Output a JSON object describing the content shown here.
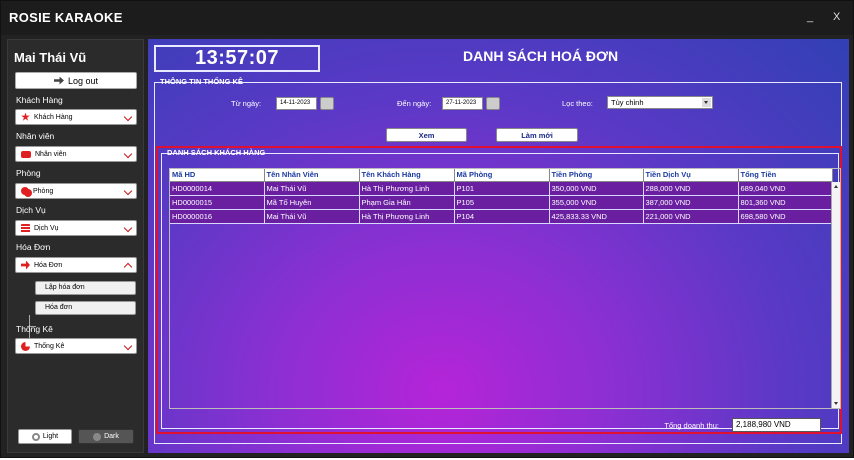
{
  "window": {
    "title": "ROSIE KARAOKE",
    "minimize": "_",
    "close": "X"
  },
  "sidebar": {
    "user_name": "Mai Thái Vũ",
    "logout_label": "Log out",
    "sections": [
      {
        "label": "Khách Hàng",
        "combo": "Khách Hàng",
        "icon": "star-icon"
      },
      {
        "label": "Nhân viên",
        "combo": "Nhân viên",
        "icon": "users-icon"
      },
      {
        "label": "Phòng",
        "combo": "Phòng",
        "icon": "room-icon"
      },
      {
        "label": "Dịch Vụ",
        "combo": "Dịch Vụ",
        "icon": "service-icon"
      },
      {
        "label": "Hóa Đơn",
        "combo": "Hóa Đơn",
        "icon": "invoice-icon"
      },
      {
        "label": "Thống Kê",
        "combo": "Thống Kê",
        "icon": "pie-chart-icon"
      }
    ],
    "invoice_subitems": [
      "Lập hóa đơn",
      "Hóa đơn"
    ],
    "light_label": "Light",
    "dark_label": "Dark"
  },
  "main": {
    "clock": "13:57:07",
    "page_title": "DANH SÁCH HOÁ ĐƠN",
    "stats_group_title": "THÔNG TIN THỐNG KÊ",
    "from_label": "Từ ngày:",
    "from_value": "14-11-2023",
    "to_label": "Đến ngày:",
    "to_value": "27-11-2023",
    "filter_label": "Lọc theo:",
    "filter_value": "Tùy chỉnh",
    "view_button": "Xem",
    "refresh_button": "Làm mới",
    "list_group_title": "DANH SÁCH KHÁCH HÀNG",
    "columns": [
      "Mã HD",
      "Tên Nhân Viên",
      "Tên Khách Hàng",
      "Mã Phòng",
      "Tiền Phòng",
      "Tiền Dịch Vụ",
      "Tổng Tiền"
    ],
    "rows": [
      [
        "HD0000014",
        "Mai Thái Vũ",
        "Hà Thị Phương Linh",
        "P101",
        "350,000 VND",
        "288,000 VND",
        "689,040 VND"
      ],
      [
        "HD0000015",
        "Mã Tố Huyên",
        "Phạm Gia Hân",
        "P105",
        "355,000 VND",
        "387,000 VND",
        "801,360 VND"
      ],
      [
        "HD0000016",
        "Mai Thái Vũ",
        "Hà Thị Phương Linh",
        "P104",
        "425,833.33 VND",
        "221,000 VND",
        "698,580 VND"
      ]
    ],
    "total_label": "Tổng doanh thu:",
    "total_value": "2,188,980 VND"
  }
}
